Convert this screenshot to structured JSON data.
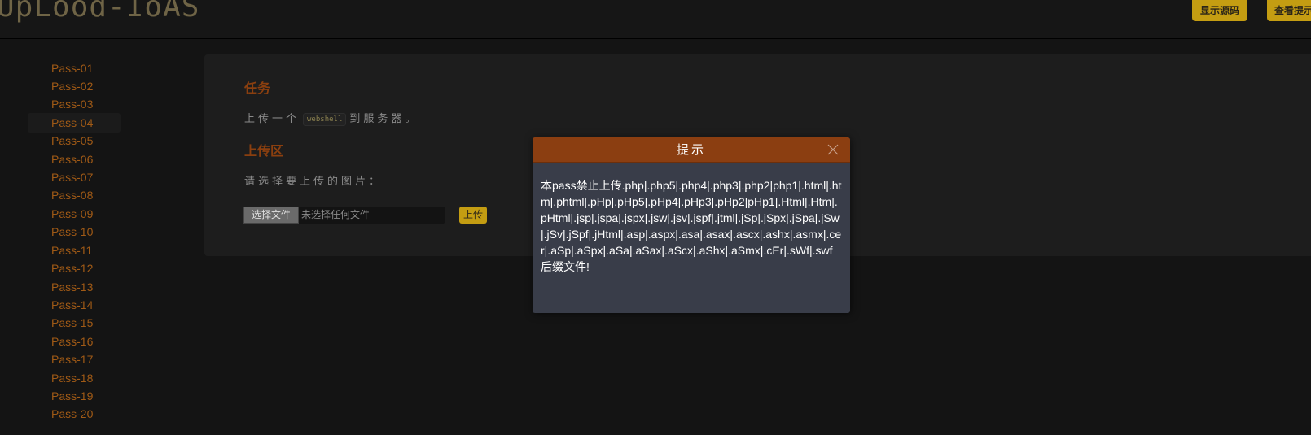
{
  "header": {
    "logo_text": "UpLood-IoAS",
    "show_source_label": "显示源码",
    "view_hint_label": "查看提示"
  },
  "sidebar": {
    "active_index": 3,
    "items": [
      {
        "label": "Pass-01"
      },
      {
        "label": "Pass-02"
      },
      {
        "label": "Pass-03"
      },
      {
        "label": "Pass-04"
      },
      {
        "label": "Pass-05"
      },
      {
        "label": "Pass-06"
      },
      {
        "label": "Pass-07"
      },
      {
        "label": "Pass-08"
      },
      {
        "label": "Pass-09"
      },
      {
        "label": "Pass-10"
      },
      {
        "label": "Pass-11"
      },
      {
        "label": "Pass-12"
      },
      {
        "label": "Pass-13"
      },
      {
        "label": "Pass-14"
      },
      {
        "label": "Pass-15"
      },
      {
        "label": "Pass-16"
      },
      {
        "label": "Pass-17"
      },
      {
        "label": "Pass-18"
      },
      {
        "label": "Pass-19"
      },
      {
        "label": "Pass-20"
      }
    ]
  },
  "main": {
    "task_title": "任务",
    "task_prefix": "上传一个",
    "task_code": "webshell",
    "task_suffix": "到服务器。",
    "upload_title": "上传区",
    "upload_prompt": "请选择要上传的图片：",
    "file_button_label": "选择文件",
    "file_status": "未选择任何文件",
    "upload_button_label": "上传"
  },
  "dialog": {
    "title": "提示",
    "message": "本pass禁止上传.php|.php5|.php4|.php3|.php2|php1|.html|.htm|.phtml|.pHp|.pHp5|.pHp4|.pHp3|.pHp2|pHp1|.Html|.Htm|.pHtml|.jsp|.jspa|.jspx|.jsw|.jsv|.jspf|.jtml|.jSp|.jSpx|.jSpa|.jSw|.jSv|.jSpf|.jHtml|.asp|.aspx|.asa|.asax|.ascx|.ashx|.asmx|.cer|.aSp|.aSpx|.aSa|.aSax|.aScx|.aShx|.aSmx|.cEr|.sWf|.swf后缀文件!"
  },
  "colors": {
    "accent": "#c49d12",
    "sidebar_text": "#a05a16",
    "section_title": "#8a3f0f",
    "dialog_title_bg": "#8b3e11",
    "dialog_body_bg": "#393d49"
  }
}
